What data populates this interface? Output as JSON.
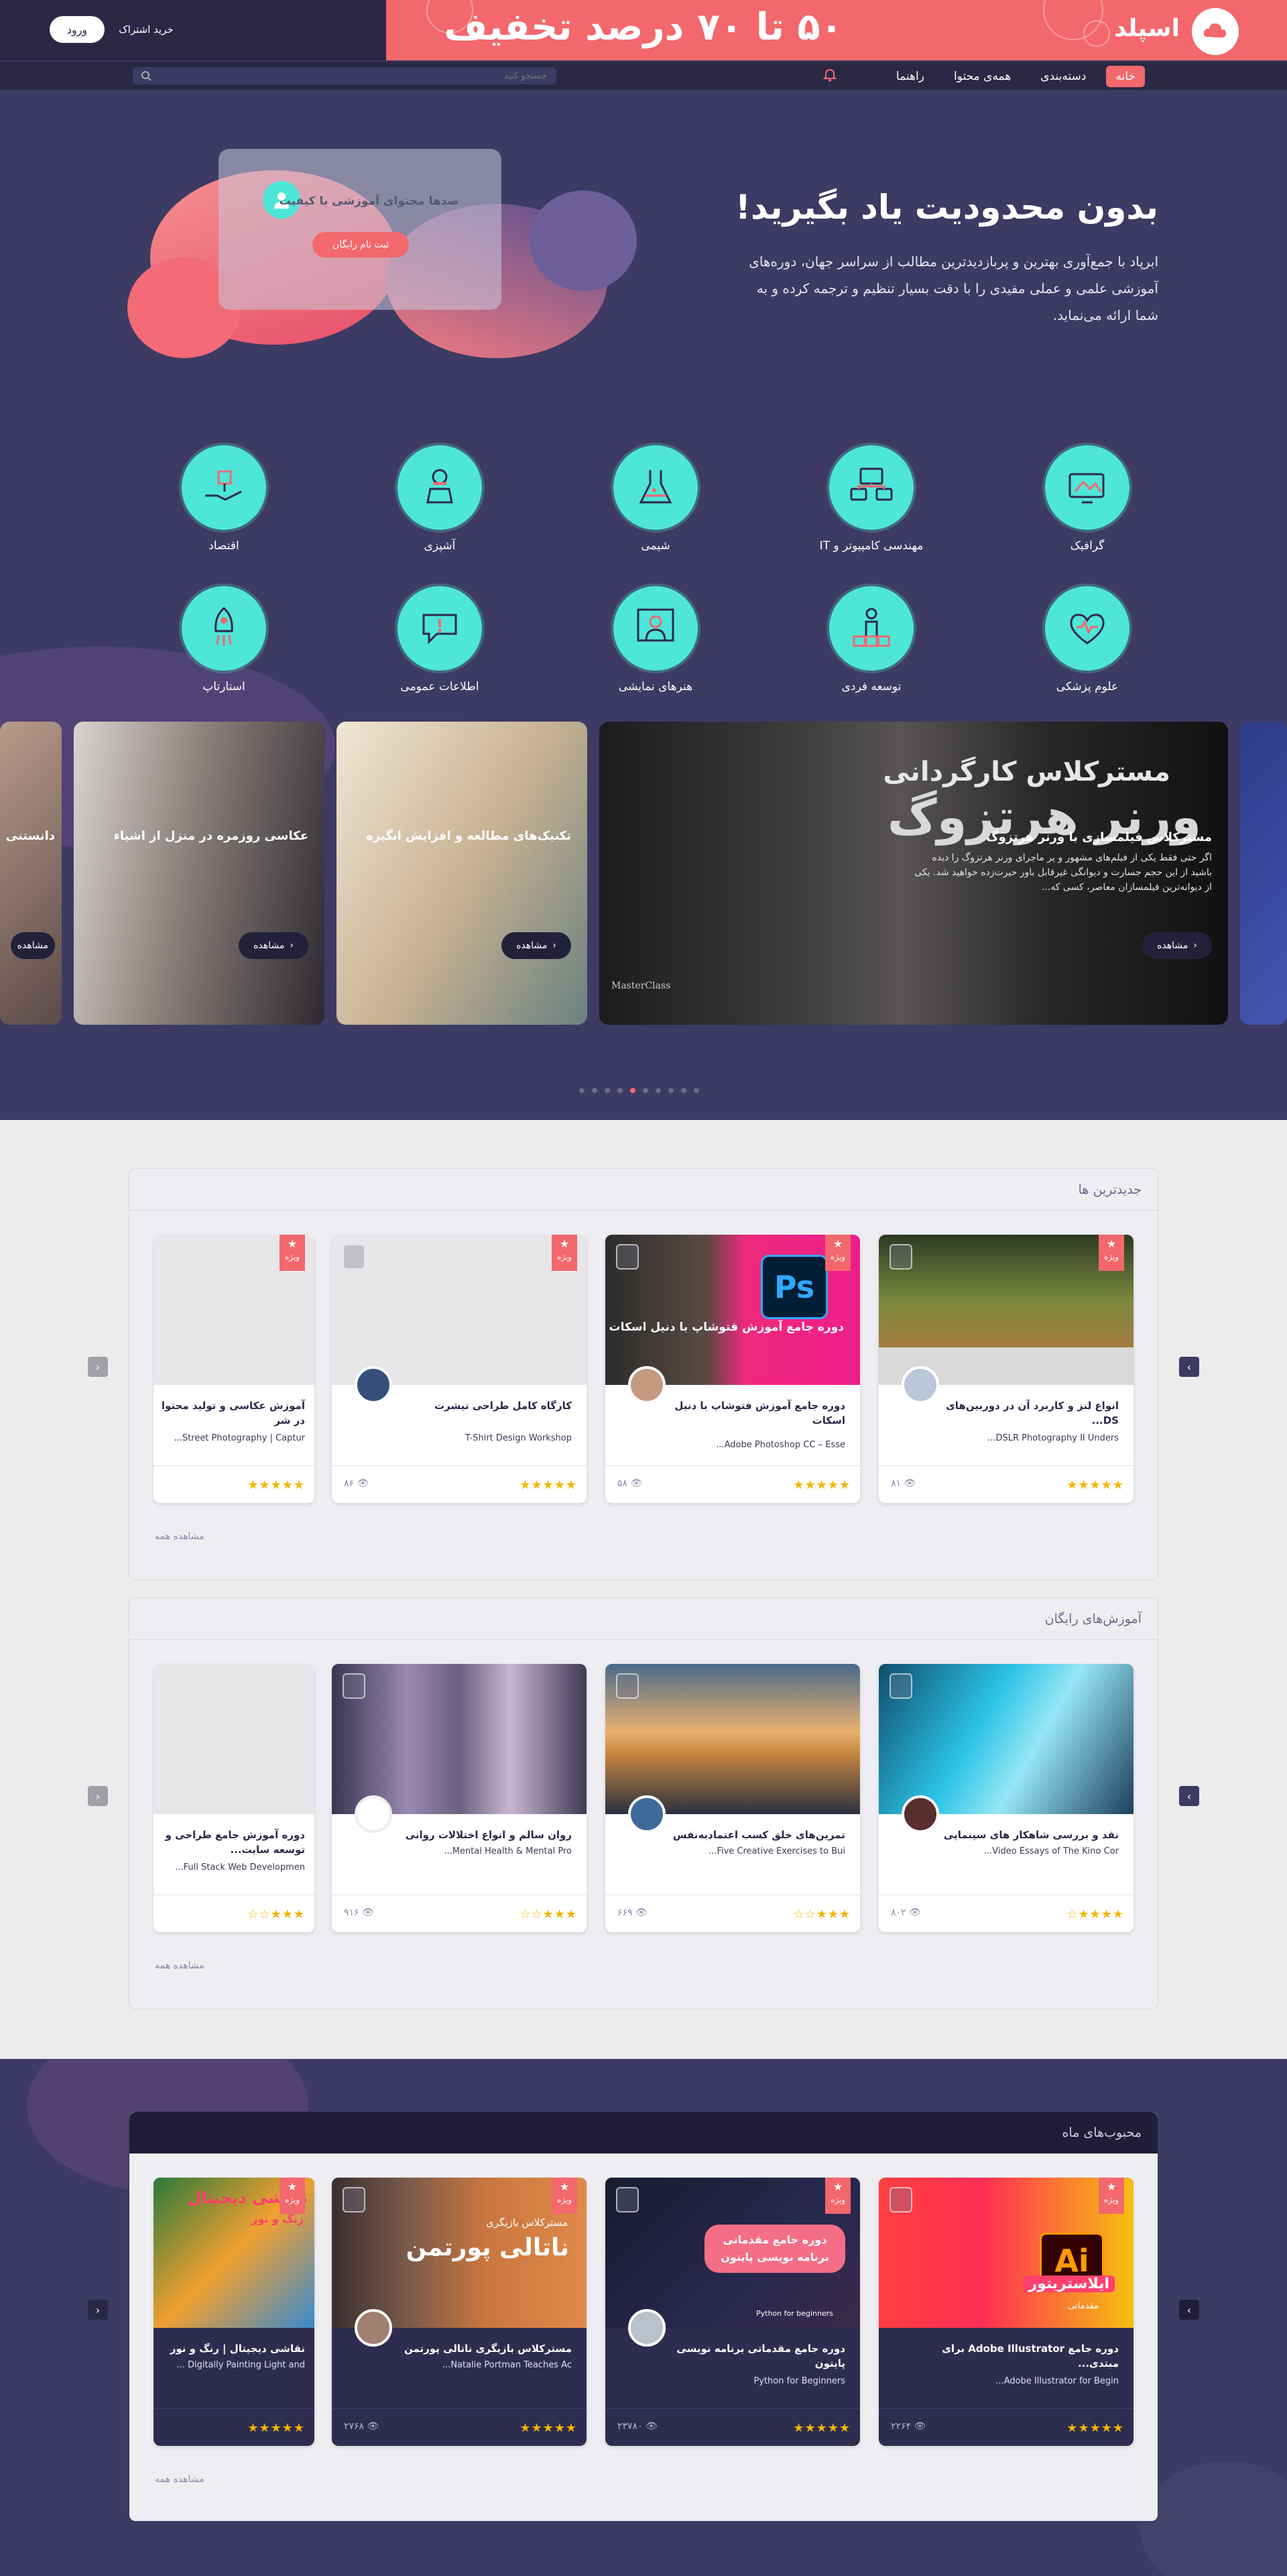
{
  "promo": {
    "text": "۵۰ تا ۷۰ درصد تخفیف",
    "logo_text": "اسپلد",
    "buy_label": "خرید اشتراک",
    "login_label": "ورود"
  },
  "nav": {
    "items": [
      "خانه",
      "دسته‌بندی",
      "همه‌ی محتوا",
      "راهنما"
    ],
    "search_placeholder": "جستجو کنید"
  },
  "hero": {
    "title": "بدون محدودیت یاد بگیرید!",
    "description": "ابرپاد با جمع‌آوری بهترین و پربازدیدترین مطالب از سراسر جهان، دوره‌های آموزشی علمی و عملی مفیدی را با دقت بسیار تنظیم و ترجمه کرده و به شما ارائه می‌نماید.",
    "card_text": "صدها محتوای آموزشی با کیفیت",
    "card_button": "ثبت نام رایگان"
  },
  "categories": [
    {
      "label": "گرافیک",
      "icon": "graphic-icon"
    },
    {
      "label": "مهندسی کامپیوتر و IT",
      "icon": "computer-icon"
    },
    {
      "label": "شیمی",
      "icon": "chemistry-icon"
    },
    {
      "label": "آشپزی",
      "icon": "cooking-icon"
    },
    {
      "label": "اقتصاد",
      "icon": "economy-icon"
    },
    {
      "label": "علوم پزشکی",
      "icon": "medical-icon"
    },
    {
      "label": "توسعه فردی",
      "icon": "personal-growth-icon"
    },
    {
      "label": "هنرهای نمایشی",
      "icon": "performing-arts-icon"
    },
    {
      "label": "اطلاعات عمومی",
      "icon": "general-info-icon"
    },
    {
      "label": "استارتاپ",
      "icon": "startup-icon"
    }
  ],
  "slides": {
    "featured": {
      "heading1": "مسترکلاس کارگردانی",
      "heading2": "ورنر هرتزوگ",
      "title": "مسترکلاس فیلمسازی با ورنر هرتزوگ",
      "description": "اگر حتی فقط یکی از فیلم‌های مشهور و پر ماجرای ورنر هرتزوگ را دیده باشید از این حجم جسارت و دیوانگی غیرقابل باور حیرت‌زده خواهید شد. یکی از دیوانه‌ترین فیلمسازان معاصر، کسی که...",
      "button": "مشاهده",
      "brand": "MasterClass"
    },
    "others": [
      {
        "title": "تکنیک‌های مطالعه و افزایش انگیزه",
        "button": "مشاهده"
      },
      {
        "title": "عکاسی روزمره در منزل از اشیاء",
        "button": "مشاهده"
      },
      {
        "title": "دانستنی",
        "button": "مشاهده"
      }
    ]
  },
  "newest": {
    "title": "جدیدترین ها",
    "see_all": "مشاهده همه",
    "cards": [
      {
        "title": "انواع لنز و کاربرد آن در دوربین‌های DS...",
        "subtitle": "DSLR Photography II Unders...",
        "views": "۸۱",
        "badge": "ویژه",
        "stars": "★★★★★"
      },
      {
        "title": "دوره جامع آموزش فتوشاپ با دنیل اسکات",
        "subtitle": "Adobe Photoshop CC – Esse...",
        "views": "۵۸",
        "badge": "ویژه",
        "stars": "★★★★★",
        "img_text": "دوره جامع آموزش فتوشاپ با دنیل اسکات"
      },
      {
        "title": "کارگاه کامل طراحی تیشرت",
        "subtitle": "T-Shirt Design Workshop",
        "views": "۸۶",
        "badge": "ویژه",
        "stars": "★★★★★"
      },
      {
        "title": "آموزش عکاسی و تولید محتوا در شر",
        "subtitle": "Street Photography | Captur...",
        "views": "",
        "badge": "ویژه",
        "stars": "★★★★★"
      }
    ]
  },
  "free": {
    "title": "آموزش‌های رایگان",
    "see_all": "مشاهده همه",
    "cards": [
      {
        "title": "نقد و بررسی شاهکار های سینمایی",
        "subtitle": "Video Essays of The Kino Cor...",
        "views": "۸۰۲",
        "stars": "★★★★☆"
      },
      {
        "title": "تمرین‌های خلق کسب اعتماد‌به‌نفس",
        "subtitle": "Five Creative Exercises to Bui...",
        "views": "۶۶۹",
        "stars": "★★★☆☆"
      },
      {
        "title": "روان سالم و انواع اختلالات روانی",
        "subtitle": "Mental Health & Mental Pro...",
        "views": "۹۱۶",
        "stars": "★★★☆☆"
      },
      {
        "title": "دوره آموزش جامع طراحی و توسعه سایت...",
        "subtitle": "Full Stack Web Developmen...",
        "views": "",
        "stars": "★★★☆☆"
      }
    ]
  },
  "popular": {
    "title": "محبوب‌های ماه",
    "see_all": "مشاهده همه",
    "cards": [
      {
        "title": "دوره جامع Adobe Illustrator برای مبتدی...",
        "subtitle": "Adobe Illustrator for Begin...",
        "views": "۲۲۶۴",
        "badge": "ویژه",
        "stars": "★★★★★",
        "img_text": "ایلاستریتور",
        "img_sub": "مقدماتی"
      },
      {
        "title": "دوره جامع مقدماتی برنامه نویسی پایتون",
        "subtitle": "Python for Beginners",
        "views": "۲۳۷۸۰",
        "badge": "ویژه",
        "stars": "★★★★★",
        "img_text": "دوره جامع مقدماتی برنامه نویسی پایتون",
        "img_sub": "Python for beginners"
      },
      {
        "title": "مسترکلاس بازیگری ناتالی پورتمن",
        "subtitle": "Natalie Portman Teaches Ac...",
        "views": "۲۷۶۸",
        "badge": "ویژه",
        "stars": "★★★★★",
        "img_text": "ناتالی پورتمن",
        "img_sub": "مسترکلاس بازیگری"
      },
      {
        "title": "نقاشی دیجیتال | رنگ و نور",
        "subtitle": "Digitally Painting Light and ...",
        "views": "",
        "badge": "ویژه",
        "stars": "★★★★★",
        "img_text": "نقاشی دیجیتال",
        "img_sub": "رنگ و نور"
      }
    ]
  },
  "colors": {
    "accent": "#f2686d",
    "navy": "#2a2845",
    "teal": "#4ee6d8",
    "star": "#f4b400"
  }
}
